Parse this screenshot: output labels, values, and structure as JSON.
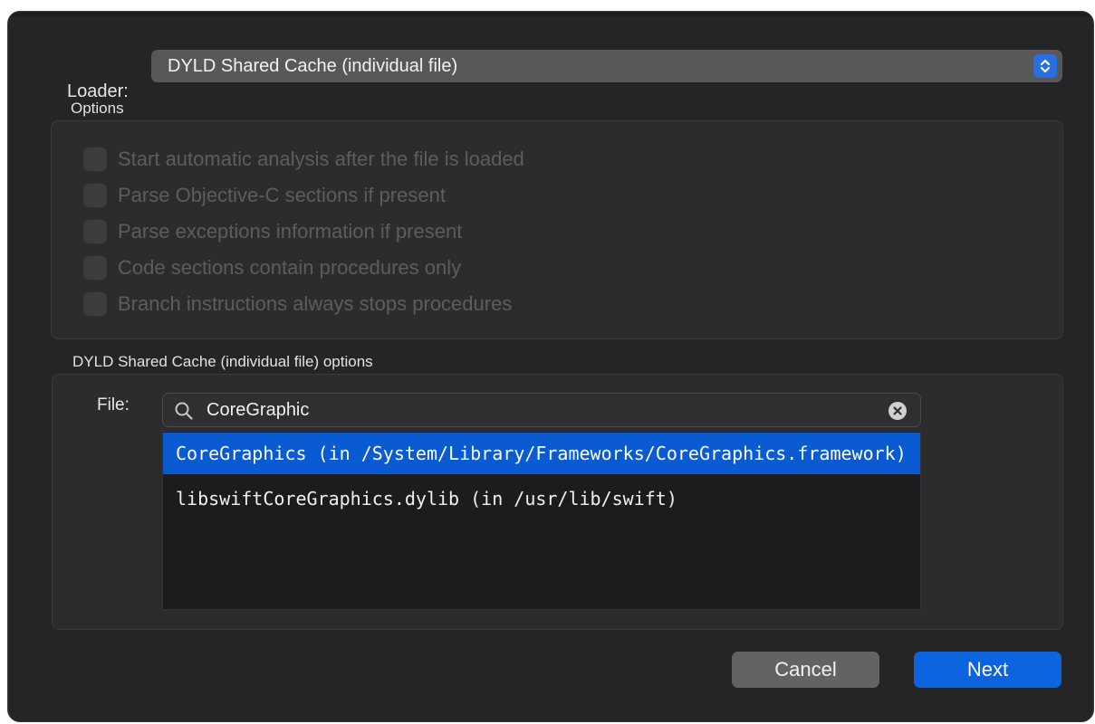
{
  "loader": {
    "label": "Loader:",
    "selected": "DYLD Shared Cache (individual file)"
  },
  "options": {
    "title": "Options",
    "items": [
      {
        "label": "Start automatic analysis after the file is loaded",
        "checked": false,
        "enabled": false
      },
      {
        "label": "Parse Objective-C sections if present",
        "checked": false,
        "enabled": false
      },
      {
        "label": "Parse exceptions information if present",
        "checked": false,
        "enabled": false
      },
      {
        "label": "Code sections contain procedures only",
        "checked": false,
        "enabled": false
      },
      {
        "label": "Branch instructions always stops procedures",
        "checked": false,
        "enabled": false
      }
    ]
  },
  "dyld_options": {
    "title": "DYLD Shared Cache (individual file) options",
    "file_label": "File:",
    "search_value": "CoreGraphic",
    "results": [
      {
        "label": "CoreGraphics (in /System/Library/Frameworks/CoreGraphics.framework)",
        "selected": true
      },
      {
        "label": "libswiftCoreGraphics.dylib (in /usr/lib/swift)",
        "selected": false
      }
    ]
  },
  "buttons": {
    "cancel": "Cancel",
    "next": "Next"
  },
  "colors": {
    "accent": "#0b63e0",
    "selection": "#0a5bd1",
    "dialog_bg": "#252527"
  }
}
